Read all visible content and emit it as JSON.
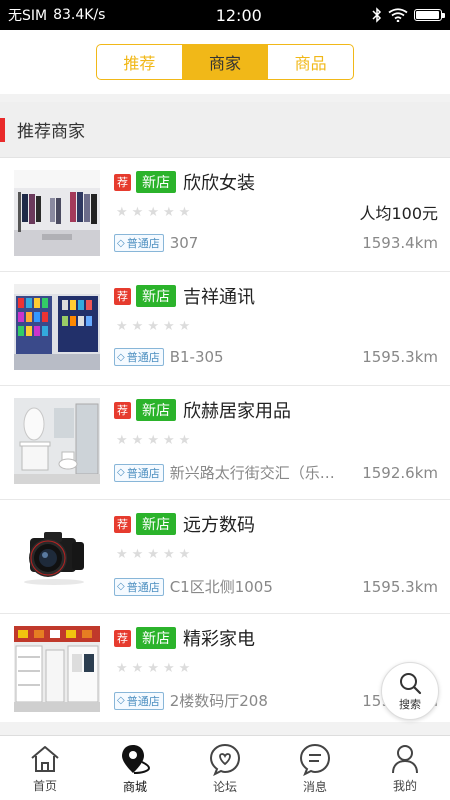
{
  "status_bar": {
    "carrier": "无SIM",
    "speed": "83.4K/s",
    "time": "12:00",
    "battery_level": 0.95
  },
  "segments": [
    {
      "label": "推荐",
      "active": false
    },
    {
      "label": "商家",
      "active": true
    },
    {
      "label": "商品",
      "active": false
    }
  ],
  "section": {
    "title": "推荐商家"
  },
  "shops": [
    {
      "rec_tag": "荐",
      "new_tag": "新店",
      "name": "欣欣女装",
      "rating": 0,
      "avg_price": "人均100元",
      "level": "普通店",
      "address": "307",
      "distance": "1593.4km",
      "thumb": "clothing"
    },
    {
      "rec_tag": "荐",
      "new_tag": "新店",
      "name": "吉祥通讯",
      "rating": 0,
      "avg_price": "",
      "level": "普通店",
      "address": "B1-305",
      "distance": "1595.3km",
      "thumb": "phones"
    },
    {
      "rec_tag": "荐",
      "new_tag": "新店",
      "name": "欣赫居家用品",
      "rating": 0,
      "avg_price": "",
      "level": "普通店",
      "address": "新兴路太行街交汇（乐…",
      "distance": "1592.6km",
      "thumb": "bathroom"
    },
    {
      "rec_tag": "荐",
      "new_tag": "新店",
      "name": "远方数码",
      "rating": 0,
      "avg_price": "",
      "level": "普通店",
      "address": "C1区北侧1005",
      "distance": "1595.3km",
      "thumb": "camera"
    },
    {
      "rec_tag": "荐",
      "new_tag": "新店",
      "name": "精彩家电",
      "rating": 0,
      "avg_price": "",
      "level": "普通店",
      "address": "2楼数码厅208",
      "distance": "1595.3km",
      "thumb": "appliances"
    }
  ],
  "search_fab": {
    "label": "搜索"
  },
  "tabs": [
    {
      "label": "首页",
      "icon": "home-icon"
    },
    {
      "label": "商城",
      "icon": "map-pin-icon",
      "active": true
    },
    {
      "label": "论坛",
      "icon": "heart-chat-icon"
    },
    {
      "label": "消息",
      "icon": "message-icon"
    },
    {
      "label": "我的",
      "icon": "user-icon"
    }
  ],
  "colors": {
    "accent": "#f1b818",
    "rec_tag": "#e63b2e",
    "new_tag": "#2bb32b",
    "section_bar": "#e92a2a"
  }
}
